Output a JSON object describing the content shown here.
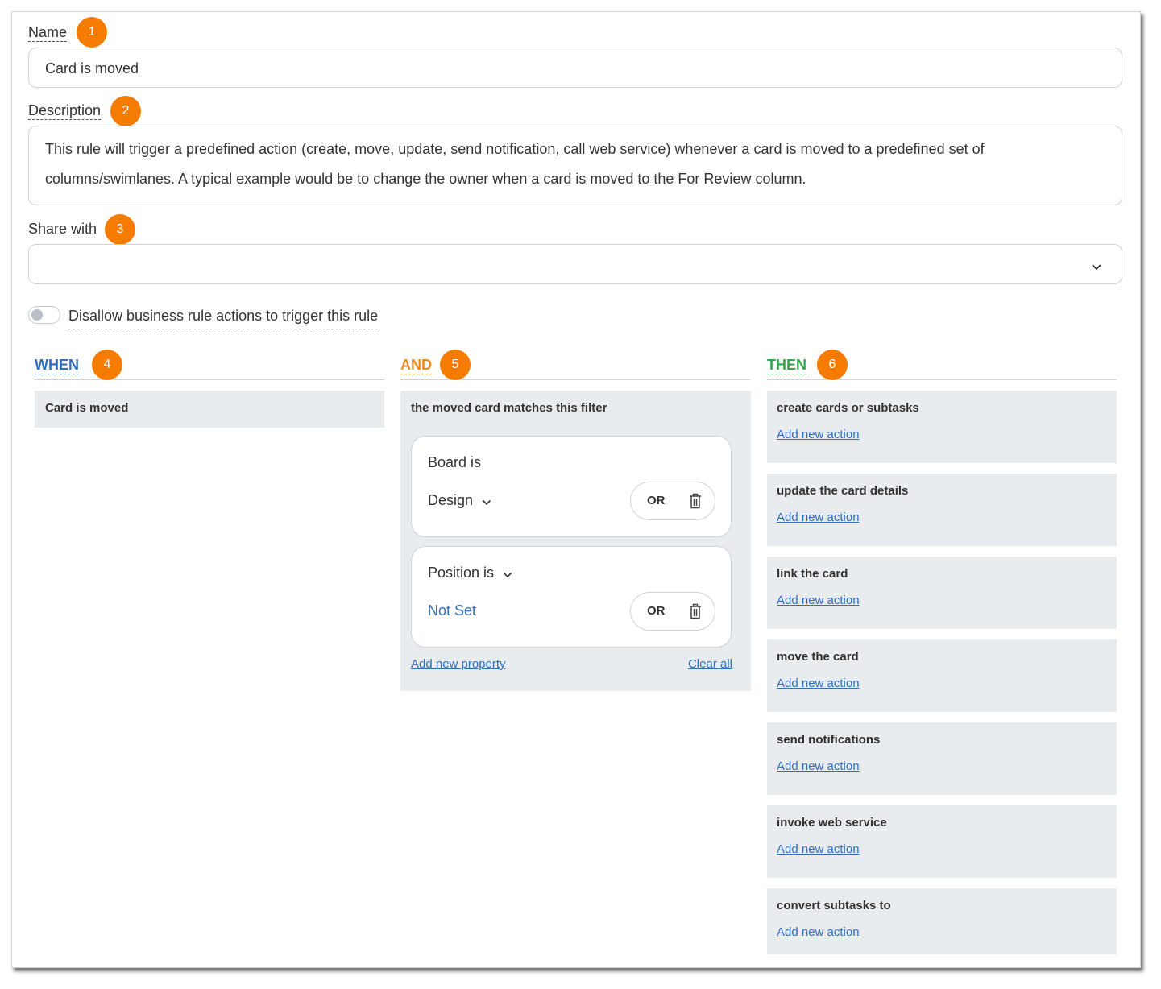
{
  "name": {
    "label": "Name",
    "badge": "1",
    "value": "Card is moved"
  },
  "description": {
    "label": "Description",
    "badge": "2",
    "line1": "This rule will trigger a predefined action (create, move, update, send notification, call web service) whenever a card is moved to a predefined set of",
    "line2": "columns/swimlanes. A typical example would be to change the owner when a card is moved to the For Review column."
  },
  "share": {
    "label": "Share with",
    "badge": "3",
    "value": "",
    "icon": "chevron-down-icon"
  },
  "toggle": {
    "label": "Disallow business rule actions to trigger this rule",
    "checked": false
  },
  "colors": {
    "accent": "#f57c00",
    "when": "#2f6fbf",
    "and": "#f08a1c",
    "then": "#3aa64a",
    "link": "#2f6fbf",
    "panel": "#e9ecef"
  },
  "when": {
    "title": "WHEN",
    "badge": "4",
    "item": "Card is moved"
  },
  "and": {
    "title": "AND",
    "badge": "5",
    "panel_title": "the moved card matches this filter",
    "filters": [
      {
        "label": "Board is",
        "value": "Design",
        "or": "OR"
      },
      {
        "label": "Position is",
        "value": "Not Set",
        "or": "OR"
      }
    ],
    "add_property": "Add new property",
    "clear_all": "Clear all"
  },
  "then": {
    "title": "THEN",
    "badge": "6",
    "add_action": "Add new action",
    "items": [
      "create cards or subtasks",
      "update the card details",
      "link the card",
      "move the card",
      "send notifications",
      "invoke web service",
      "convert subtasks to"
    ]
  }
}
